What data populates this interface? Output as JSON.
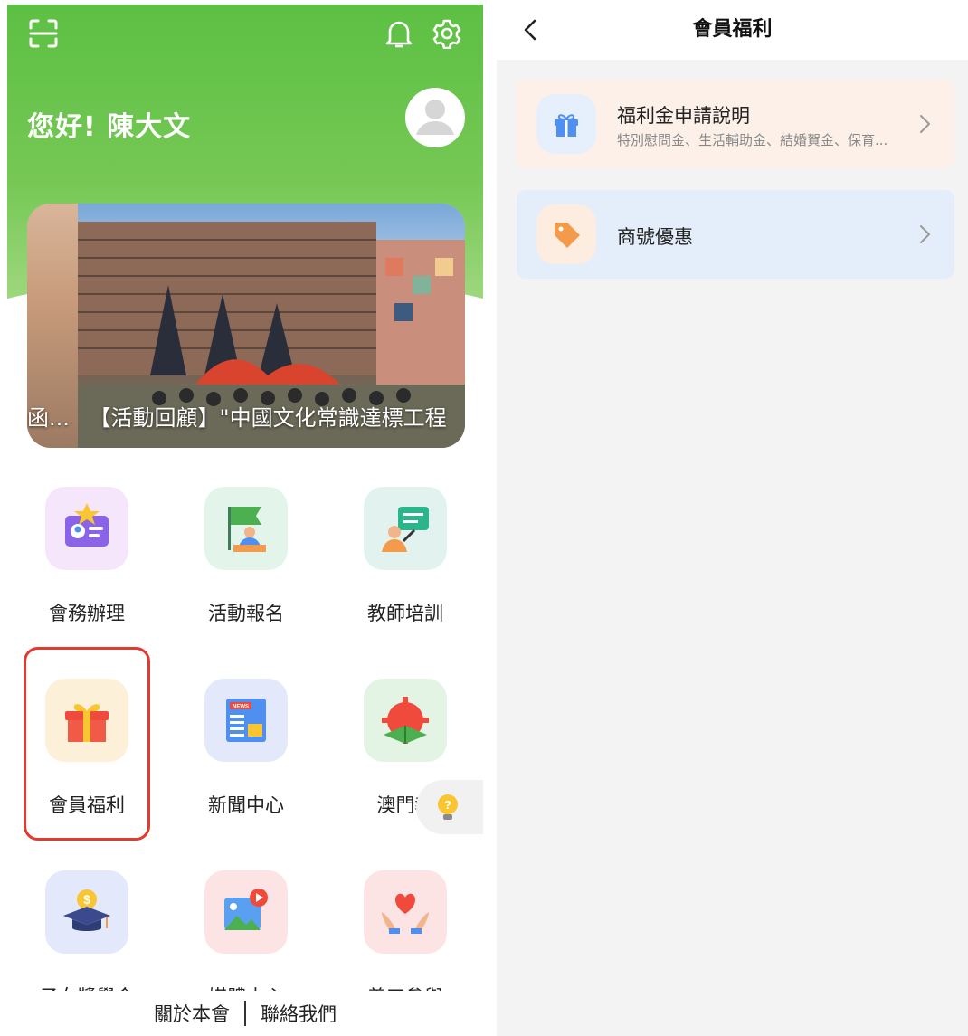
{
  "home": {
    "greeting": "您好! 陳大文",
    "banner": {
      "caption_prev": "函...",
      "caption": "【活動回顧】\"中國文化常識達標工程"
    },
    "grid": [
      {
        "label": "會務辦理",
        "icon": "member-card-icon",
        "bg": "#f6e6fb"
      },
      {
        "label": "活動報名",
        "icon": "flag-presenter-icon",
        "bg": "#e3f5ea"
      },
      {
        "label": "教師培訓",
        "icon": "teacher-board-icon",
        "bg": "#e2f3ef"
      },
      {
        "label": "會員福利",
        "icon": "gift-icon",
        "bg": "#fdf0d9"
      },
      {
        "label": "新聞中心",
        "icon": "news-icon",
        "bg": "#e3e8fb"
      },
      {
        "label": "澳門教",
        "icon": "book-gear-icon",
        "bg": "#e4f4e4"
      },
      {
        "label": "子女獎學金",
        "icon": "graduation-cap-icon",
        "bg": "#e3e8fb"
      },
      {
        "label": "媒體中心",
        "icon": "media-image-icon",
        "bg": "#fde4e4"
      },
      {
        "label": "義工參與",
        "icon": "heart-hands-icon",
        "bg": "#fde4e4"
      }
    ],
    "footer": {
      "about": "關於本會",
      "contact": "聯絡我們"
    }
  },
  "benefits": {
    "title": "會員福利",
    "cards": [
      {
        "title": "福利金申請說明",
        "subtitle": "特別慰問金、生活輔助金、結婚賀金、保育...",
        "bg": "#fdf0e8",
        "icon": "gift-icon"
      },
      {
        "title": "商號優惠",
        "subtitle": "",
        "bg": "#e4eefa",
        "icon": "tag-icon"
      }
    ]
  },
  "colors": {
    "brand_green": "#5cc043",
    "highlight_red": "#e23a2e",
    "icon_orange": "#f39b4a",
    "icon_blue": "#4f8ff0"
  }
}
